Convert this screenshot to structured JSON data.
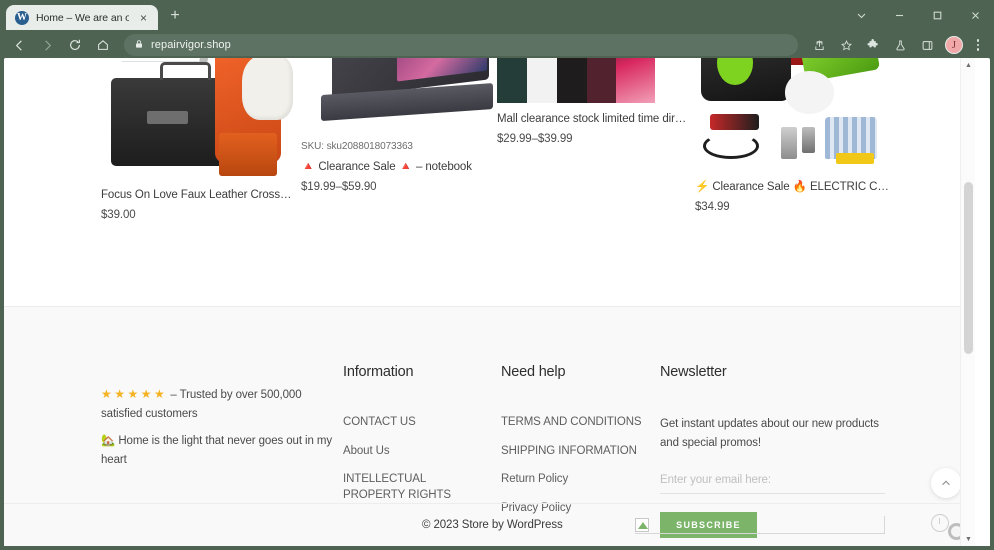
{
  "browser": {
    "tab": {
      "title": "Home – We are an online retail",
      "favicon": "wordpress-icon",
      "close_label": "×"
    },
    "newtab_label": "+",
    "window_controls": [
      "chevron-down-icon",
      "minimize-icon",
      "maximize-icon",
      "close-icon"
    ],
    "toolbar": {
      "back": "back-icon",
      "forward": "forward-icon",
      "reload": "reload-icon",
      "home": "home-icon",
      "url": "repairvigor.shop",
      "lock": "lock-icon",
      "share": "share-icon",
      "bookmark": "star-icon",
      "extensions": "puzzle-icon",
      "lab": "flask-icon",
      "sidepanel": "split-panel-icon",
      "avatar_initial": "J",
      "menu": "kebab-menu-icon"
    }
  },
  "products": [
    {
      "title": "Focus On Love Faux Leather Crossb…",
      "price": "$39.00",
      "sku": "",
      "image_alt": "orange-cordless-drill-with-black-tool-case"
    },
    {
      "title": "🔺 Clearance Sale 🔺  – notebook",
      "price": "$19.99–$59.90",
      "sku": "SKU: sku2088018073363",
      "image_alt": "grey-laptop-with-colorful-screen"
    },
    {
      "title": "Mall clearance stock limited time dir…",
      "price": "$29.99–$39.99",
      "sku": "",
      "image_alt": "phone-color-swatches-teal-white-black-maroon"
    },
    {
      "title": "⚡ Clearance Sale 🔥 ELECTRIC CA…",
      "price": "$34.99",
      "sku": "",
      "image_alt": "green-black-electric-car-air-pump-kit"
    }
  ],
  "footer": {
    "trust": {
      "stars": "★★★★★",
      "star_color": "#f5b322",
      "text": "– Trusted by over 500,000 satisfied customers",
      "tagline": "🏡 Home is the light that never goes out in my heart"
    },
    "columns": [
      {
        "heading": "Information",
        "links": [
          "CONTACT US",
          "About Us",
          "INTELLECTUAL PROPERTY RIGHTS"
        ]
      },
      {
        "heading": "Need help",
        "links": [
          "TERMS AND CONDITIONS",
          "SHIPPING INFORMATION",
          "Return Policy",
          "Privacy Policy"
        ]
      }
    ],
    "newsletter": {
      "heading": "Newsletter",
      "description": "Get instant updates about our new products and special promos!",
      "placeholder": "Enter your email here:",
      "value": "",
      "button_label": "SUBSCRIBE",
      "button_color": "#7cb46a"
    },
    "copyright": "© 2023 Store by WordPress"
  },
  "widgets": {
    "scroll_top": "chevron-up-icon",
    "corner": "clock-globe-widget"
  }
}
